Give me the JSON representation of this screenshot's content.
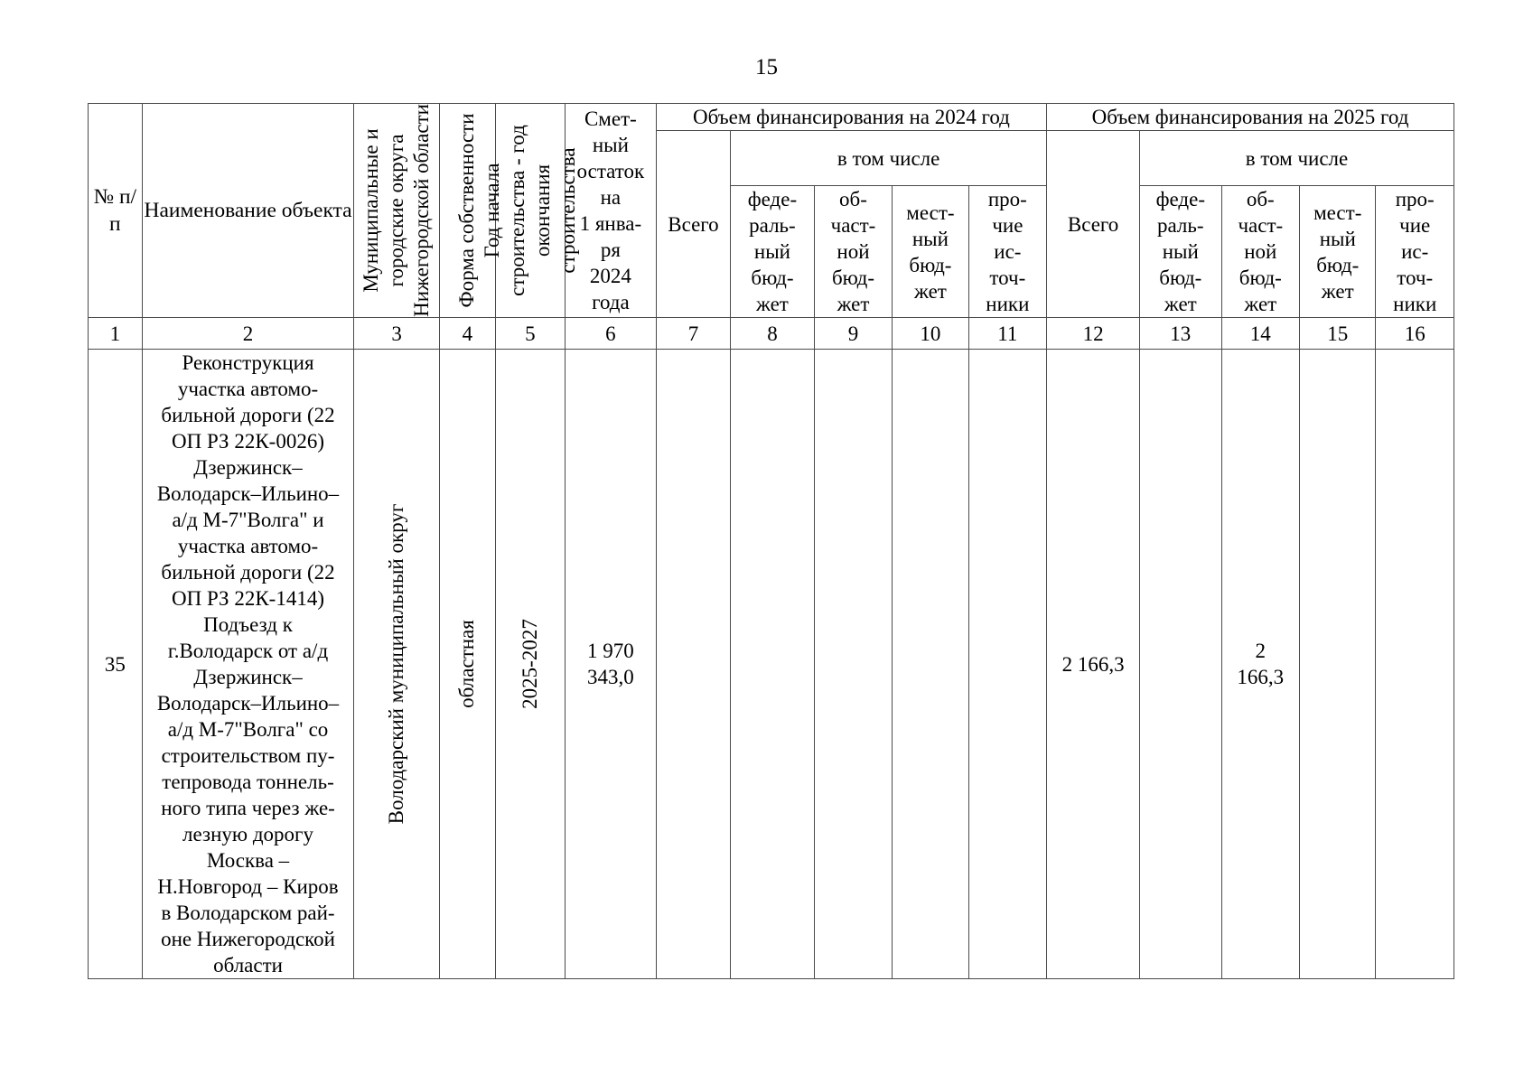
{
  "page": {
    "number": "15"
  },
  "table": {
    "headers": {
      "col1": "№\nп/п",
      "col1_line1": "№",
      "col1_line2": "п/п",
      "col2_line1": "Наименование",
      "col2_line2": "объекта",
      "col3": "Муниципальные  и  городские округа Нижегородской области",
      "col4": "Форма собственности",
      "col5": "Год начала строительства - год окончания строительства",
      "col6_lines": [
        "Смет-",
        "ный",
        "остаток",
        "на",
        "1 янва-",
        "ря",
        "2024",
        "года"
      ],
      "group_2024": "Объем финансирования на 2024 год",
      "group_2025": "Объем финансирования на 2025 год",
      "v_tom_chisle": "в том числе",
      "vsego": "Всего",
      "federal_lines": [
        "феде-",
        "раль-",
        "ный",
        "бюд-",
        "жет"
      ],
      "oblast_lines": [
        "об-",
        "част-",
        "ной",
        "бюд-",
        "жет"
      ],
      "mestny_lines": [
        "мест-",
        "ный",
        "бюд-",
        "жет"
      ],
      "prochie_lines": [
        "про-",
        "чие",
        "ис-",
        "точ-",
        "ники"
      ]
    },
    "column_numbers": [
      "1",
      "2",
      "3",
      "4",
      "5",
      "6",
      "7",
      "8",
      "9",
      "10",
      "11",
      "12",
      "13",
      "14",
      "15",
      "16"
    ],
    "rows": [
      {
        "num": "35",
        "object_name_lines": [
          "Реконструкция",
          "участка автомо-",
          "бильной дороги (22",
          "ОП РЗ 22К-0026)",
          "Дзержинск–",
          "Володарск–Ильино–",
          "а/д М-7\"Волга\" и",
          "участка автомо-",
          "бильной дороги (22",
          "ОП РЗ 22К-1414)",
          "Подъезд к",
          "г.Володарск от а/д",
          "Дзержинск–",
          "Володарск–Ильино–",
          "а/д М-7\"Волга\" со",
          "строительством пу-",
          "тепровода тоннель-",
          "ного типа через же-",
          "лезную дорогу",
          "Москва –",
          "Н.Новгород – Киров",
          "в Володарском рай-",
          "оне Нижегородской",
          "области"
        ],
        "municipality": "Володарский муниципальный округ",
        "ownership": "областная",
        "years": "2025-2027",
        "estimate_remainder_lines": [
          "1 970",
          "343,0"
        ],
        "y2024_total": "",
        "y2024_federal": "",
        "y2024_oblast": "",
        "y2024_local": "",
        "y2024_other": "",
        "y2025_total": "2 166,3",
        "y2025_federal": "",
        "y2025_oblast_lines": [
          "2",
          "166,3"
        ],
        "y2025_local": "",
        "y2025_other": ""
      }
    ]
  }
}
